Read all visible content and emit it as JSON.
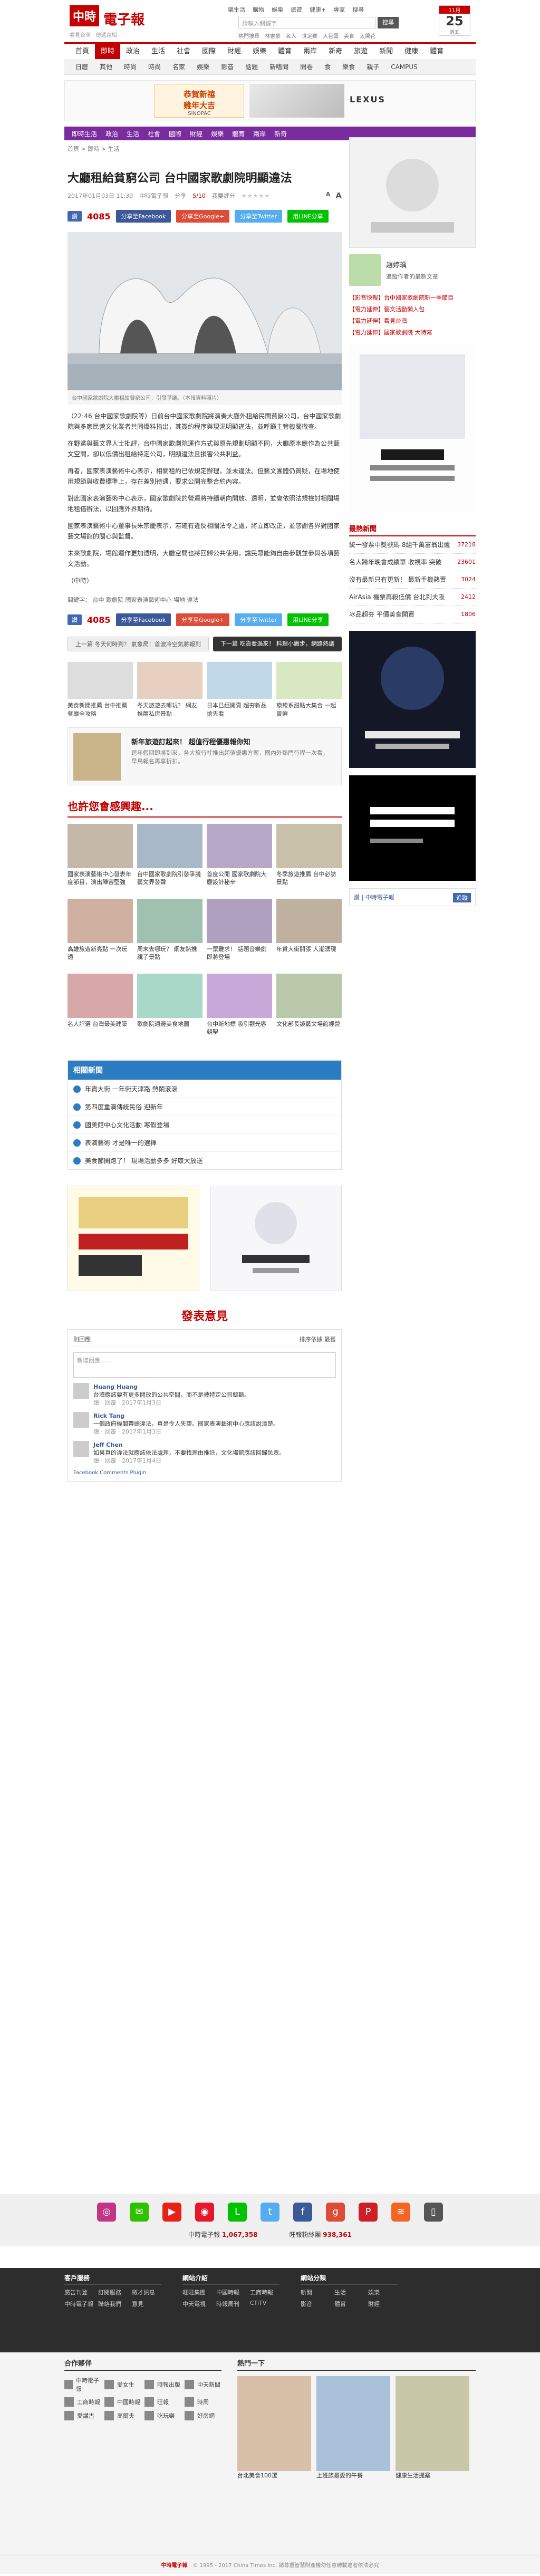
{
  "site": {
    "logo_mark": "中時",
    "logo_text": "電子報",
    "logo_sub": "看見台灣 · 傳遞真相",
    "top_links": [
      "樂生活",
      "購物",
      "娛樂",
      "旅遊",
      "健康+",
      "專家",
      "搜尋"
    ],
    "search_placeholder": "請輸入關鍵字",
    "search_button": "搜尋",
    "hot_tags": [
      "熱門搜尋",
      "林書豪",
      "名人",
      "世足賽",
      "大巨蛋",
      "美食",
      "太陽花"
    ],
    "weather_month": "11月",
    "weather_day": "25",
    "weather_weekday": "週五"
  },
  "nav_main": [
    {
      "label": "首頁",
      "active": false
    },
    {
      "label": "即時",
      "active": true
    },
    {
      "label": "政治",
      "active": false
    },
    {
      "label": "生活",
      "active": false
    },
    {
      "label": "社會",
      "active": false
    },
    {
      "label": "國際",
      "active": false
    },
    {
      "label": "財經",
      "active": false
    },
    {
      "label": "娛樂",
      "active": false
    },
    {
      "label": "體育",
      "active": false
    },
    {
      "label": "兩岸",
      "active": false
    },
    {
      "label": "新奇",
      "active": false
    },
    {
      "label": "旅遊",
      "active": false
    },
    {
      "label": "新聞",
      "active": false
    },
    {
      "label": "健康",
      "active": false
    },
    {
      "label": "體育",
      "active": false
    }
  ],
  "nav_sub": [
    {
      "label": "日曆",
      "active": false
    },
    {
      "label": "其他",
      "active": false
    },
    {
      "label": "時尚",
      "active": false
    },
    {
      "label": "時尚",
      "active": false
    },
    {
      "label": "名家",
      "active": false
    },
    {
      "label": "娛樂",
      "active": false
    },
    {
      "label": "影音",
      "active": false
    },
    {
      "label": "話題",
      "active": false
    },
    {
      "label": "新嗜聞",
      "active": false
    },
    {
      "label": "開卷",
      "active": false
    },
    {
      "label": "食",
      "active": false
    },
    {
      "label": "樂食",
      "active": false
    },
    {
      "label": "親子",
      "active": false
    },
    {
      "label": "CAMPUS",
      "active": false
    }
  ],
  "ad_banner": {
    "left_title": "恭賀新禧",
    "left_title2": "雞年大吉",
    "left_brand": "SINOPAC",
    "right_brand": "LEXUS"
  },
  "subnav": [
    "即時生活",
    "政治",
    "生活",
    "社會",
    "國際",
    "財經",
    "娛樂",
    "體育",
    "兩岸",
    "新奇"
  ],
  "breadcrumb": "首頁 > 即時 > 生活",
  "article": {
    "title": "大廳租給貧窮公司 台中國家歌劇院明顯違法",
    "datetime": "2017年01月03日 11:39",
    "source": "中時電子報",
    "vote_label": "分享",
    "score": "5/10",
    "rate_label": "我要評分",
    "font_small": "A",
    "font_large": "A",
    "like_label": "讚",
    "share_count": "4085",
    "share_fb": "分享至Facebook",
    "share_gp": "分享至Google+",
    "share_tw": "分享至Twitter",
    "share_line": "用LINE分享",
    "photo_caption": "台中國家歌劇院大廳租給貧窮公司，引發爭議。（本報資料照片）",
    "paragraphs": [
      "（22:46 台中國家歌劇院等）日前台中國家歌劇院將演奏大廳外租給民間貧窮公司，台中國家歌劇院與多家民營文化業者共同爆料指出，其簽約程序與現況明顯違法，並呼籲主管機關徹查。",
      "在野黨與藝文界人士批評，台中國家歌劇院運作方式與原先規劃明顯不同，大廳原本應作為公共藝文空間，卻以低價出租給特定公司，明顯違法且損害公共利益。",
      "再者，國家表演藝術中心表示，相關租約已依規定辦理，並未違法。但藝文團體仍質疑，在場地使用規範與收費標準上，存在差別待遇，要求公開完整合約內容。",
      "對此國家表演藝術中心表示，國家歌劇院的營運將持續朝向開放、透明，並會依照法規檢討相關場地租借辦法，以回應外界期待。",
      "國家表演藝術中心董事長朱宗慶表示，若確有違反相關法令之處，將立即改正，並感謝各界對國家藝文場館的關心與監督。",
      "未來歌劇院，場館運作更加透明，大廳空間也將回歸公共使用，讓民眾能夠自由參觀並參與各項藝文活動。",
      "（中時）"
    ],
    "tags_label": "關鍵字：",
    "tags": [
      "台中",
      "歌劇院",
      "國家表演藝術中心",
      "場地",
      "違法"
    ],
    "prev_label": "上一篇",
    "next_label": "下一篇",
    "prev_title": "冬天何時到？ 氣象局：首波冷空氣將報到",
    "next_title": "吃貨看過來！ 料理小撇步，網路熱議"
  },
  "related_ads": [
    {
      "title": "美食新聞推薦 台中推薦餐廳全攻略"
    },
    {
      "title": "冬天旅遊去哪玩？ 網友推薦私房景點"
    },
    {
      "title": "日本已經開賣 超夯新品搶先看"
    },
    {
      "title": "療癒系甜點大集合 一起嘗鮮"
    }
  ],
  "promo": {
    "title": "新年旅遊訂起來！ 超值行程優惠報你知",
    "desc": "跨年假期即將到來，各大旅行社推出超值優惠方案，國內外熱門行程一次看，早鳥報名再享折扣。"
  },
  "may_like": {
    "title": "也許您會感興趣...",
    "items": [
      {
        "title": "國家表演藝術中心發表年度節目，演出陣容堅強"
      },
      {
        "title": "台中國家歌劇院引發爭議 藝文界發聲"
      },
      {
        "title": "首度公開 國家歌劇院大廳設計秘辛"
      },
      {
        "title": "冬季旅遊推薦 台中必訪景點"
      },
      {
        "title": "高雄旅遊新亮點 一次玩透"
      },
      {
        "title": "周末去哪玩？ 網友熱推親子景點"
      },
      {
        "title": "一票難求！ 話題音樂劇即將登場"
      },
      {
        "title": "年貨大街開張 人潮湧現"
      },
      {
        "title": "名人評選 台灣最美建築"
      },
      {
        "title": "歌劇院週邊美食地圖"
      },
      {
        "title": "台中新地標 吸引觀光客朝聖"
      },
      {
        "title": "文化部長談藝文場館經營"
      }
    ]
  },
  "hot_list": {
    "title": "相關新聞",
    "items": [
      "年貨大街 一年街天津路 熱鬧滾滾",
      "第四度重演傳統民俗 迎新年",
      "國美館中心文化活動 寒假登場",
      "表演藝術 才是唯一的選擇",
      "美食節開跑了！ 現場活動多多 好康大放送"
    ]
  },
  "comments": {
    "title": "發表意見",
    "count_label": "則回應",
    "sort_label": "排序依據",
    "sort_value": "最舊",
    "input_placeholder": "新增回應……",
    "items": [
      {
        "name": "Huang Huang",
        "text": "台灣應該要有更多開放的公共空間，而不是被特定公司壟斷。",
        "date": "讚 · 回覆 · 2017年1月3日"
      },
      {
        "name": "Rick Tang",
        "text": "一個政府機關帶頭違法，真是令人失望。國家表演藝術中心應該說清楚。",
        "date": "讚 · 回覆 · 2017年1月3日"
      },
      {
        "name": "Jeff Chen",
        "text": "如果真的違法就應該依法處理，不要找理由推託，文化場館應該回歸民眾。",
        "date": "讚 · 回覆 · 2017年1月4日"
      }
    ],
    "plugin_label": "Facebook Comments Plugin"
  },
  "sidebar": {
    "reporter_name": "趙婷瑀",
    "reporter_desc": "追蹤作者的最新文章",
    "links": [
      "【影音快報】台中國家歌劇院新一季節目",
      "【電力延伸】藝文活動懶人包",
      "【電力延伸】看見台灣",
      "【電力延伸】國家歌劇院 大特寫"
    ],
    "hot_title": "最熱新聞",
    "hot_items": [
      {
        "title": "統一發票中獎號碼 8組千萬富翁出爐",
        "views": "37218"
      },
      {
        "title": "名人跨年晚會成績單 收視率 突破",
        "views": "23601"
      },
      {
        "title": "沒有最新只有更新！ 最新手機熱賣",
        "views": "3024"
      },
      {
        "title": "AirAsia 機票再殺低價 台北到大阪",
        "views": "2412"
      },
      {
        "title": "冰品超夯 平價美食開賣",
        "views": "1806"
      }
    ],
    "fb_label": "讚 | 中時電子報",
    "follow_label": "追蹤"
  },
  "social_icons": [
    "instagram",
    "wechat",
    "youtube",
    "weibo",
    "line",
    "twitter",
    "facebook",
    "google-plus",
    "pinterest",
    "rss",
    "mobile"
  ],
  "footer": {
    "col1_title": "客戶服務",
    "col1_items": [
      "廣告刊登",
      "訂閱服務",
      "徵才訊息",
      "中時電子報",
      "聯絡我們",
      "意見"
    ],
    "col2_title": "網站介紹",
    "col2_items": [
      "旺旺集團",
      "中國時報",
      "工商時報",
      "中天電視",
      "時報周刊",
      "CTiTV"
    ],
    "col3_title": "網站分類",
    "col3_items": [
      "新聞",
      "生活",
      "娛樂",
      "影音",
      "體育",
      "財經"
    ],
    "fb_fans_label": "中時電子報",
    "fb_fans_count": "1,067,358",
    "fb_fans2_label": "旺報粉絲團",
    "fb_fans2_count": "938,361"
  },
  "partners": {
    "title": "合作夥伴",
    "items": [
      "中時電子報",
      "愛女生",
      "時報出版",
      "中天新聞",
      "工商時報",
      "中國時報",
      "旺報",
      "時周",
      "愛講古",
      "高爾夫",
      "吃玩樂",
      "好房網"
    ],
    "promo_title": "熱門一下",
    "promo_items": [
      "台北美食100選",
      "上班族最愛的午餐",
      "健康生活提案"
    ]
  },
  "copyright": "© 1995 - 2017 China Times Inc. 請尊重智慧財產權勿任意轉載違者依法必究"
}
